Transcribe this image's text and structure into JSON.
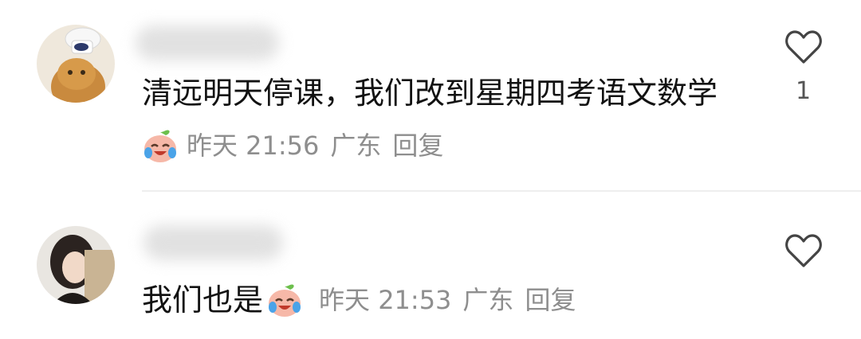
{
  "comments": [
    {
      "text": "清远明天停课，我们改到星期四考语文数学",
      "time": "昨天 21:56",
      "location": "广东",
      "reply_label": "回复",
      "likes": "1"
    },
    {
      "text": "我们也是",
      "time": "昨天 21:53",
      "location": "广东",
      "reply_label": "回复",
      "likes": ""
    }
  ],
  "icons": {
    "like": "heart-outline-icon",
    "emoji": "crying-laughing-emoji"
  },
  "colors": {
    "text": "#121212",
    "meta": "#8e8e8e",
    "divider": "#eeeeee",
    "heart": "#444444"
  }
}
